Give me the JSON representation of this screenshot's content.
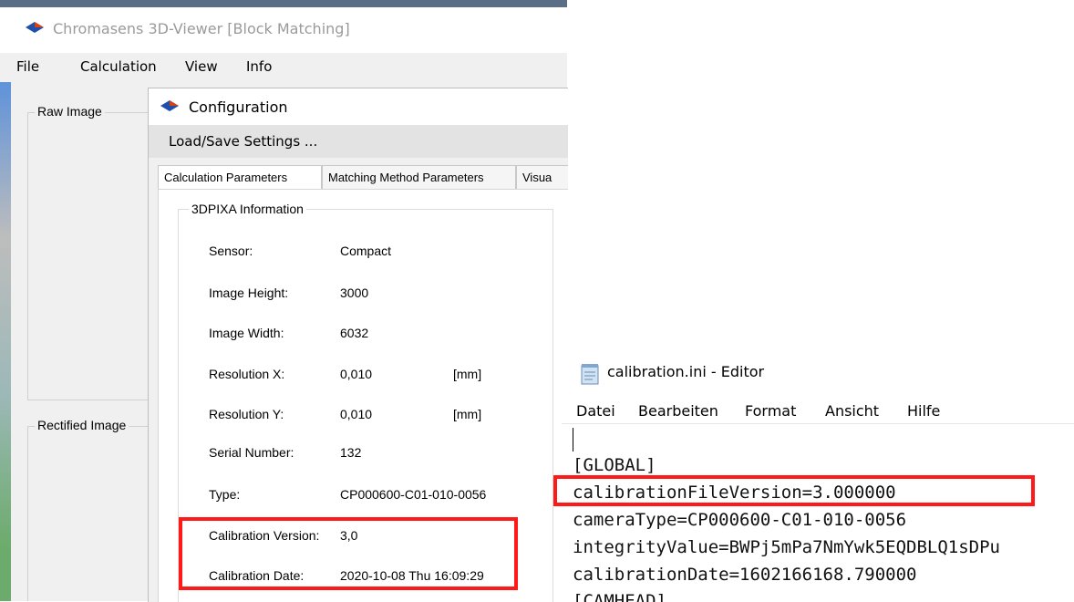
{
  "viewer": {
    "title": "Chromasens 3D-Viewer [Block Matching]",
    "menu": [
      "File",
      "Calculation",
      "View",
      "Info"
    ],
    "groups": {
      "raw_image": "Raw Image",
      "rectified_image": "Rectified Image"
    }
  },
  "config": {
    "title": "Configuration",
    "menu_label": "Load/Save Settings ...",
    "tabs": [
      "Calculation Parameters",
      "Matching Method Parameters",
      "Visua"
    ],
    "group_title": "3DPIXA Information",
    "rows": [
      {
        "label": "Sensor:",
        "value": "Compact",
        "unit": ""
      },
      {
        "label": "Image Height:",
        "value": "3000",
        "unit": ""
      },
      {
        "label": "Image Width:",
        "value": "6032",
        "unit": ""
      },
      {
        "label": "Resolution X:",
        "value": "0,010",
        "unit": "[mm]"
      },
      {
        "label": "Resolution Y:",
        "value": "0,010",
        "unit": "[mm]"
      },
      {
        "label": "Serial Number:",
        "value": "132",
        "unit": ""
      },
      {
        "label": "Type:",
        "value": "CP000600-C01-010-0056",
        "unit": ""
      },
      {
        "label": "Calibration Version:",
        "value": "3,0",
        "unit": ""
      },
      {
        "label": "Calibration Date:",
        "value": "2020-10-08 Thu 16:09:29",
        "unit": ""
      }
    ]
  },
  "editor": {
    "title": "calibration.ini - Editor",
    "menu": [
      "Datei",
      "Bearbeiten",
      "Format",
      "Ansicht",
      "Hilfe"
    ],
    "lines": [
      "[GLOBAL]",
      "calibrationFileVersion=3.000000",
      "cameraType=CP000600-C01-010-0056",
      "integrityValue=BWPj5mPa7NmYwk5EQDBLQ1sDPu",
      "calibrationDate=1602166168.790000",
      "[CAMHEAD]"
    ]
  },
  "colors": {
    "highlight": "#ff1a1a",
    "config_menu_bg": "#e3e3e3",
    "title_gray": "#9a9a9a"
  },
  "icons": {
    "app_icon": "chromasens-diamond-icon",
    "notepad_icon": "notepad-icon"
  }
}
